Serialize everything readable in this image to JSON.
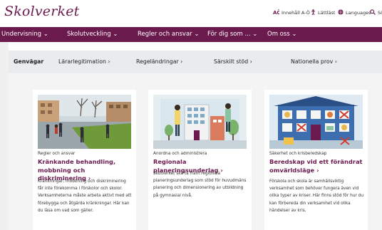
{
  "header": {
    "logo_text": "Skolverket",
    "utility": [
      {
        "icon": "ao-icon",
        "label": "Innehåll A-Ö"
      },
      {
        "icon": "accessibility-icon",
        "label": "Lättläst"
      },
      {
        "icon": "globe-icon",
        "label": "Languages"
      },
      {
        "icon": "search-icon",
        "label": "Sö"
      }
    ]
  },
  "nav": {
    "items": [
      "Undervisning ⌄",
      "Skolutveckling ⌄",
      "Regler och ansvar ⌄",
      "För dig som ... ⌄",
      "Om oss ⌄"
    ]
  },
  "shortcuts": {
    "label": "Genvägar",
    "links": [
      "Lärarlegitimation ›",
      "Regeländringar ›",
      "Särskilt stöd ›",
      "Nationella prov ›"
    ]
  },
  "cards": [
    {
      "category": "Regler och ansvar",
      "title": "Kränkande behandling, mobbning och diskriminering ›",
      "body": "Kränkningar, mobbning och diskriminering får inte förekomma i förskolor och skolor. Verksamheterna måste arbeta aktivt med att förebygga och åtgärda kränkningar. Här kan du läsa om vad som gäller."
    },
    {
      "category": "Anordna och administrera",
      "title": "Regionala planeringsunderlag ›",
      "body": "Skolverket ska ta fram regionala planeringsunderlag som stöd för huvudmäns planering och dimensionering av utbildning på gymnasial nivå."
    },
    {
      "category": "Säkerhet och krisberedskap",
      "title": "Beredskap vid ett förändrat omvärldsläge ›",
      "body": "Förskola och skola är samhällsviktig verksamhet som behöver fungera även vid olika typer av kriser. Här finns stöd för hur du kan förbereda din verksamhet vid olika händelser av kris."
    }
  ],
  "colors": {
    "brand": "#6b1a4e",
    "shortcut_bg": "#e8ecef"
  }
}
